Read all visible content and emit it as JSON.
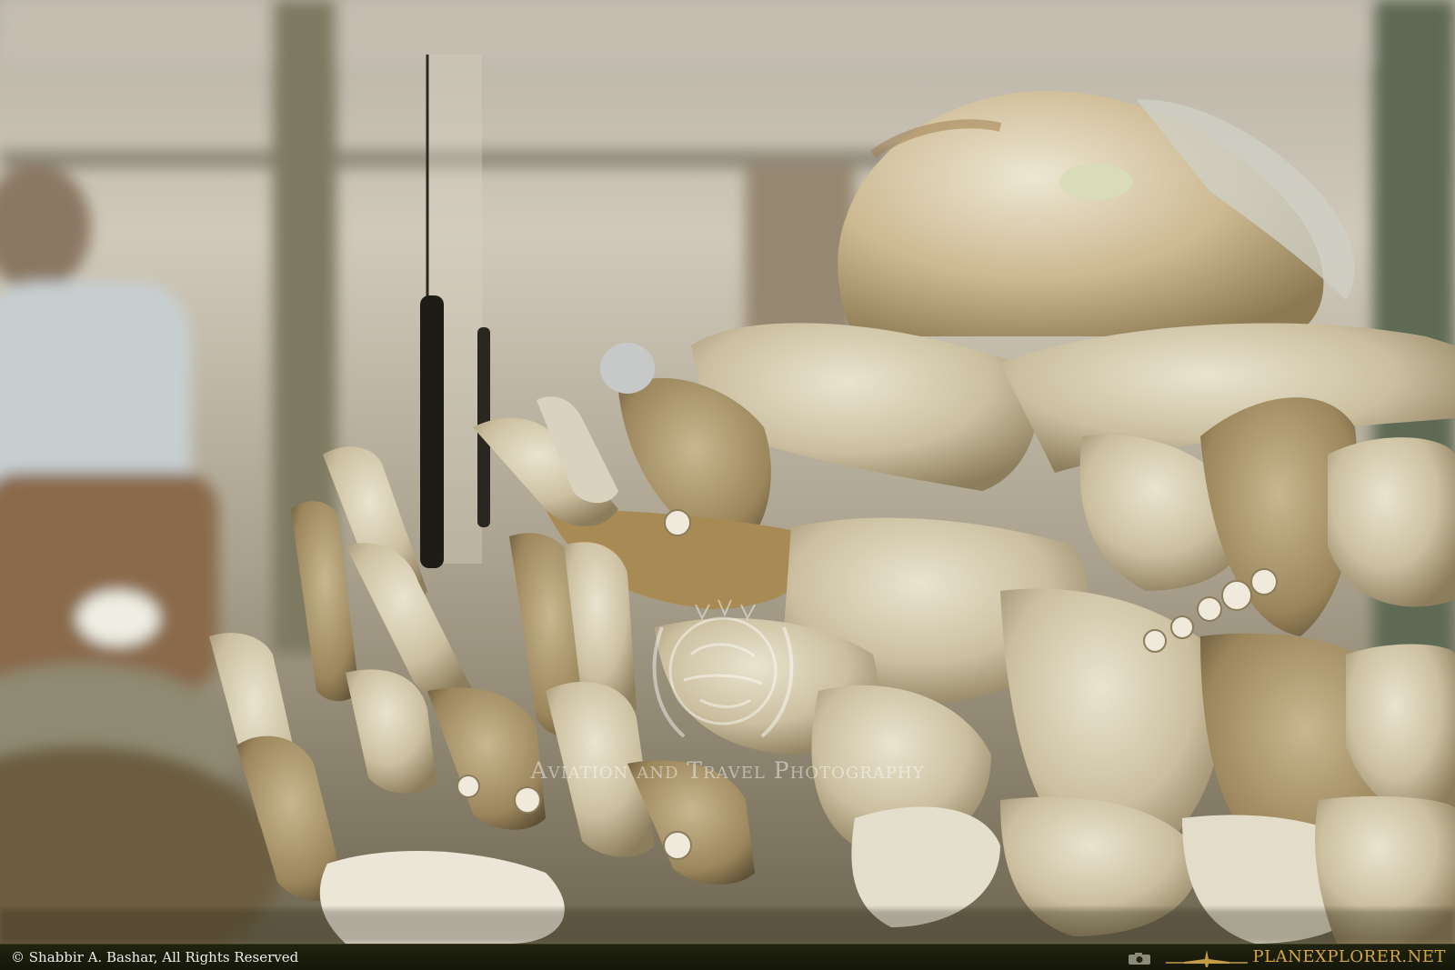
{
  "watermark": {
    "text": "Aviation and Travel Photography"
  },
  "footer": {
    "copyright": "© Shabbir A. Bashar, All Rights Reserved",
    "brand": "PLANEXPLORER.NET"
  },
  "icons": {
    "camera": "camera-icon",
    "plane": "airplane-icon",
    "emblem": "globe-laurel-emblem-icon"
  },
  "colors": {
    "footer_bg": "#1c1f0c",
    "brand": "#d4a544",
    "copyright": "#ececec"
  }
}
